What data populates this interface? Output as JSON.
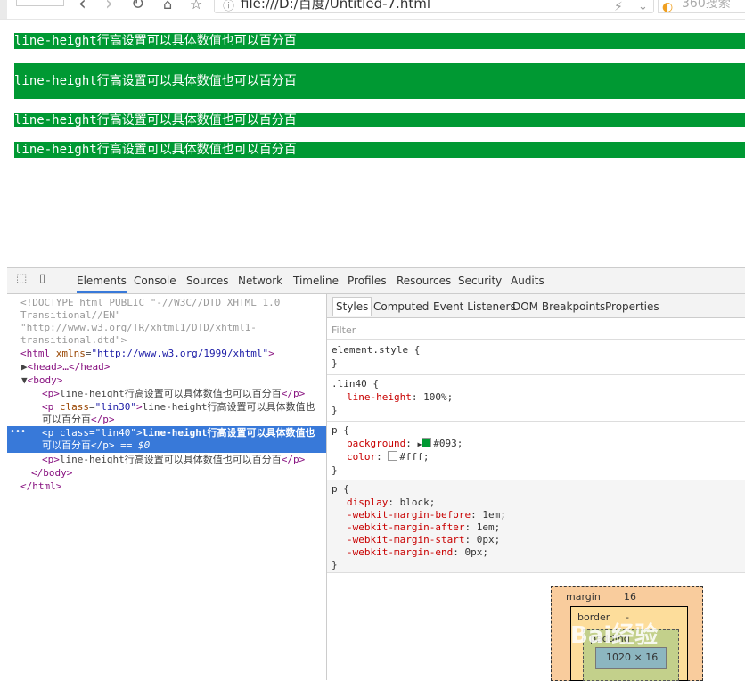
{
  "browser": {
    "url": "file:///D:/百度/Untitled-7.html",
    "search_label": "360搜索"
  },
  "page": {
    "paragraphs": [
      "line-height行高设置可以具体数值也可以百分百",
      "line-height行高设置可以具体数值也可以百分百",
      "line-height行高设置可以具体数值也可以百分百",
      "line-height行高设置可以具体数值也可以百分百"
    ]
  },
  "devtools": {
    "tabs": [
      "Elements",
      "Console",
      "Sources",
      "Network",
      "Timeline",
      "Profiles",
      "Resources",
      "Security",
      "Audits"
    ],
    "active_tab": "Elements",
    "dom": {
      "doctype_line1": "<!DOCTYPE html PUBLIC \"-//W3C//DTD XHTML 1.0",
      "doctype_line2": "Transitional//EN\"",
      "doctype_line3": "\"http://www.w3.org/TR/xhtml1/DTD/xhtml1-",
      "doctype_line4": "transitional.dtd\">",
      "html_open_tag": "<html",
      "html_attr": "xmlns",
      "html_val": "\"http://www.w3.org/1999/xhtml\"",
      "head": "<head>…</head>",
      "body_open": "<body>",
      "p_open": "<p>",
      "p_close": "</p>",
      "p_text": "line-height行高设置可以具体数值也可以百分百",
      "p_class_open": "<p",
      "attr_class": "class",
      "lin30_val": "\"lin30\"",
      "lin30_text": "line-height行高设置可以具体数值也",
      "lin30_text2": "可以百分百",
      "lin40_val": "\"lin40\"",
      "lin40_text": "line-height行高设置可以具体数值也",
      "lin40_text2": "可以百分百",
      "selected_marker": " == $0",
      "ellipsis": "•••",
      "body_close": "</body>",
      "html_close": "</html>"
    },
    "styles": {
      "subtabs": [
        "Styles",
        "Computed",
        "Event Listeners",
        "DOM Breakpoints",
        "Properties"
      ],
      "filter_placeholder": "Filter",
      "element_style": "element.style {",
      "lin40_selector": ".lin40 {",
      "line_height_prop": "line-height",
      "line_height_val": "100%;",
      "p_selector": "p {",
      "background_prop": "background",
      "background_val": "#093;",
      "color_prop": "color",
      "color_val": "#fff;",
      "display_prop": "display",
      "display_val": "block;",
      "mb_prop": "-webkit-margin-before",
      "mb_val": "1em;",
      "ma_prop": "-webkit-margin-after",
      "ma_val": "1em;",
      "ms_prop": "-webkit-margin-start",
      "ms_val": "0px;",
      "me_prop": "-webkit-margin-end",
      "me_val": "0px;",
      "close_brace": "}",
      "swatch_green": "#009933",
      "swatch_white": "#ffffff"
    },
    "box_model": {
      "margin_label": "margin",
      "margin_value": "16",
      "border_label": "border",
      "border_value": "-",
      "padding_label": "padding",
      "content_value": "1020 × 16"
    }
  },
  "watermark": "Bai经验"
}
